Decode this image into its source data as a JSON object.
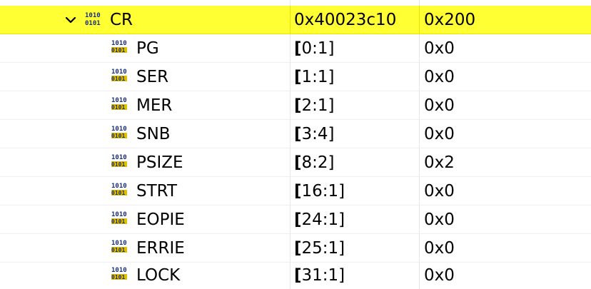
{
  "register": {
    "name": "CR",
    "address": "0x40023c10",
    "value": "0x200",
    "expanded": true,
    "icon": "binary-register-icon",
    "highlight_color": "#ffff33"
  },
  "fields": [
    {
      "name": "PG",
      "bit_open": "[",
      "bits": "0:1]",
      "value": "0x0"
    },
    {
      "name": "SER",
      "bit_open": "[",
      "bits": "1:1]",
      "value": "0x0"
    },
    {
      "name": "MER",
      "bit_open": "[",
      "bits": "2:1]",
      "value": "0x0"
    },
    {
      "name": "SNB",
      "bit_open": "[",
      "bits": "3:4]",
      "value": "0x0"
    },
    {
      "name": "PSIZE",
      "bit_open": "[",
      "bits": "8:2]",
      "value": "0x2"
    },
    {
      "name": "STRT",
      "bit_open": "[",
      "bits": "16:1]",
      "value": "0x0"
    },
    {
      "name": "EOPIE",
      "bit_open": "[",
      "bits": "24:1]",
      "value": "0x0"
    },
    {
      "name": "ERRIE",
      "bit_open": "[",
      "bits": "25:1]",
      "value": "0x0"
    },
    {
      "name": "LOCK",
      "bit_open": "[",
      "bits": "31:1]",
      "value": "0x0"
    }
  ]
}
